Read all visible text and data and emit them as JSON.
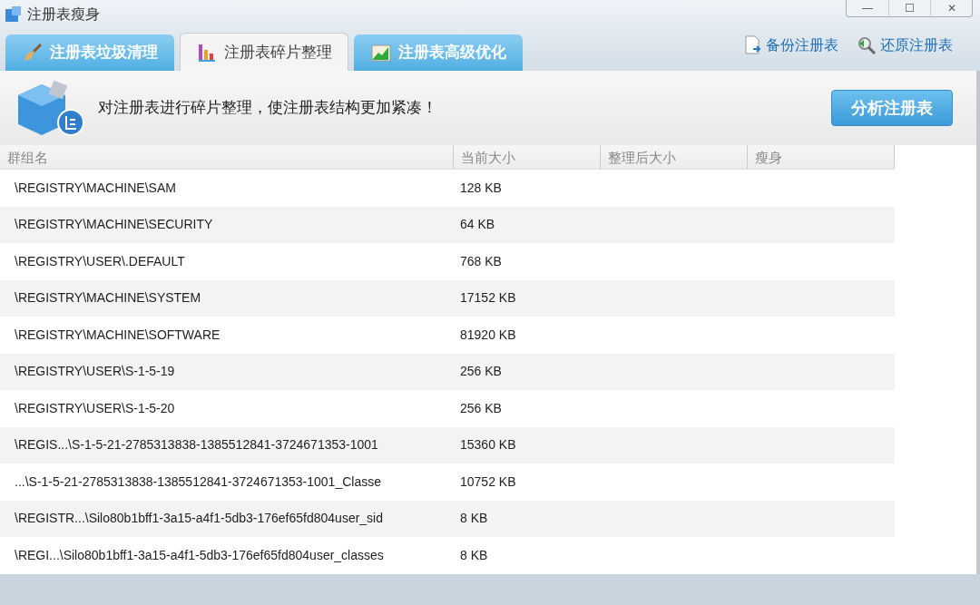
{
  "window": {
    "title": "注册表瘦身",
    "controls": [
      "—",
      "☐",
      "✕"
    ]
  },
  "tabs": [
    {
      "label": "注册表垃圾清理",
      "kind": "broom",
      "selected": false
    },
    {
      "label": "注册表碎片整理",
      "kind": "bars",
      "selected": true
    },
    {
      "label": "注册表高级优化",
      "kind": "chart",
      "selected": false
    }
  ],
  "links": [
    {
      "label": "备份注册表",
      "kind": "backup"
    },
    {
      "label": "还原注册表",
      "kind": "restore"
    }
  ],
  "banner": {
    "message": "对注册表进行碎片整理，使注册表结构更加紧凑！",
    "button": "分析注册表"
  },
  "table": {
    "columns": [
      "群组名",
      "当前大小",
      "整理后大小",
      "瘦身"
    ],
    "rows": [
      [
        "\\REGISTRY\\MACHINE\\SAM",
        "128 KB"
      ],
      [
        "\\REGISTRY\\MACHINE\\SECURITY",
        "64 KB"
      ],
      [
        "\\REGISTRY\\USER\\.DEFAULT",
        "768 KB"
      ],
      [
        "\\REGISTRY\\MACHINE\\SYSTEM",
        "17152 KB"
      ],
      [
        "\\REGISTRY\\MACHINE\\SOFTWARE",
        "81920 KB"
      ],
      [
        "\\REGISTRY\\USER\\S-1-5-19",
        "256 KB"
      ],
      [
        "\\REGISTRY\\USER\\S-1-5-20",
        "256 KB"
      ],
      [
        "\\REGIS...\\S-1-5-21-2785313838-1385512841-3724671353-1001",
        "15360 KB"
      ],
      [
        "...\\S-1-5-21-2785313838-1385512841-3724671353-1001_Classe",
        "10752 KB"
      ],
      [
        "\\REGISTR...\\Silo80b1bff1-3a15-a4f1-5db3-176ef65fd804user_sid",
        "8 KB"
      ],
      [
        "\\REGI...\\Silo80b1bff1-3a15-a4f1-5db3-176ef65fd804user_classes",
        "8 KB"
      ]
    ]
  }
}
